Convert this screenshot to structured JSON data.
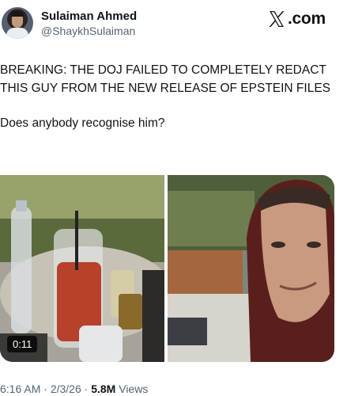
{
  "author": {
    "name": "Sulaiman Ahmed",
    "handle": "@ShaykhSulaiman"
  },
  "brand": {
    "logo_icon": "x-logo-icon",
    "text": ".com"
  },
  "tweet": {
    "headline": "BREAKING: THE DOJ FAILED TO COMPLETELY REDACT THIS GUY FROM THE NEW RELEASE OF EPSTEIN FILES",
    "question": "Does anybody recognise him?"
  },
  "media": {
    "video_duration": "0:11"
  },
  "meta": {
    "time": "6:16 AM",
    "separator": " · ",
    "date": "2/3/26",
    "views_count": "5.8M",
    "views_label": " Views"
  },
  "colors": {
    "text_primary": "#0f1419",
    "text_secondary": "#536471",
    "background": "#ffffff"
  }
}
